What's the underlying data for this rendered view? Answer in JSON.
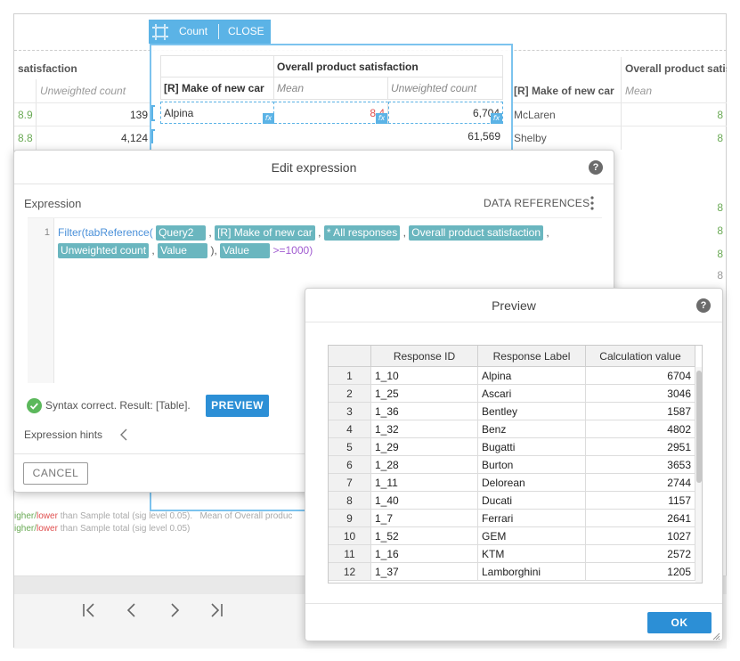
{
  "background": {
    "headers": {
      "left_partial": "satisfaction",
      "right_col": "Overall product satisfaction",
      "right_col_partial": "Overall product satis"
    },
    "subheaders": {
      "left_unweighted": "Unweighted count",
      "right_row_header": "[R] Make of new car",
      "right_mean": "Mean"
    },
    "rows": [
      {
        "left_mean": "8.9",
        "left_count": "139",
        "right_label": "McLaren",
        "right_mean": "8"
      },
      {
        "left_mean": "8.8",
        "left_count": "4,124",
        "right_label": "Shelby",
        "right_mean": "8"
      }
    ],
    "extra_right_values": [
      "8",
      "8",
      "8",
      "8",
      "8",
      "8"
    ],
    "legend": [
      {
        "prefix": "igher/",
        "lower": "lower",
        "rest": " than Sample total (sig level 0.05).",
        "extra": "Mean of Overall produc"
      },
      {
        "prefix": "igher/",
        "lower": "lower",
        "rest": " than Sample total (sig level 0.05)",
        "extra": ""
      }
    ],
    "pager": [
      "first-page",
      "previous-page",
      "next-page",
      "last-page"
    ]
  },
  "widget": {
    "toolbar": {
      "count_label": "Count",
      "close_label": "CLOSE"
    },
    "table": {
      "header": "Overall product satisfaction",
      "row_header": "[R] Make of new car",
      "mean_label": "Mean",
      "unweighted_label": "Unweighted count",
      "rows": [
        {
          "label": "Alpina",
          "mean": "8.4",
          "count": "6,704"
        },
        {
          "label": "",
          "mean": "",
          "count": "61,569"
        }
      ]
    }
  },
  "edit_dialog": {
    "title": "Edit expression",
    "expression_label": "Expression",
    "data_references_label": "DATA REFERENCES",
    "line_number": "1",
    "code": {
      "fn_filter": "Filter(",
      "fn_tabref": "tabReference(",
      "chips": [
        "Query2",
        "[R] Make of new car",
        "* All responses",
        "Overall product satisfaction",
        "Unweighted count",
        "Value",
        "Value"
      ],
      "comma": ",",
      "close_paren": ")",
      "condition": ">=1000)"
    },
    "syntax_status": "Syntax correct. Result: [Table].",
    "preview_button": "PREVIEW",
    "hints_label": "Expression hints",
    "cancel_button": "CANCEL"
  },
  "preview_dialog": {
    "title": "Preview",
    "columns": [
      "Response ID",
      "Response Label",
      "Calculation value"
    ],
    "rows": [
      {
        "n": "1",
        "id": "1_10",
        "label": "Alpina",
        "value": "6704"
      },
      {
        "n": "2",
        "id": "1_25",
        "label": "Ascari",
        "value": "3046"
      },
      {
        "n": "3",
        "id": "1_36",
        "label": "Bentley",
        "value": "1587"
      },
      {
        "n": "4",
        "id": "1_32",
        "label": "Benz",
        "value": "4802"
      },
      {
        "n": "5",
        "id": "1_29",
        "label": "Bugatti",
        "value": "2951"
      },
      {
        "n": "6",
        "id": "1_28",
        "label": "Burton",
        "value": "3653"
      },
      {
        "n": "7",
        "id": "1_11",
        "label": "Delorean",
        "value": "2744"
      },
      {
        "n": "8",
        "id": "1_40",
        "label": "Ducati",
        "value": "1157"
      },
      {
        "n": "9",
        "id": "1_7",
        "label": "Ferrari",
        "value": "2641"
      },
      {
        "n": "10",
        "id": "1_52",
        "label": "GEM",
        "value": "1027"
      },
      {
        "n": "11",
        "id": "1_16",
        "label": "KTM",
        "value": "2572"
      },
      {
        "n": "12",
        "id": "1_37",
        "label": "Lamborghini",
        "value": "1205"
      }
    ],
    "ok_button": "OK"
  },
  "colors": {
    "accent": "#2c8fd6",
    "widget_border": "#7cc3ee",
    "chip": "#6ab6bf",
    "green": "#6aaa55",
    "red": "#e05050"
  }
}
